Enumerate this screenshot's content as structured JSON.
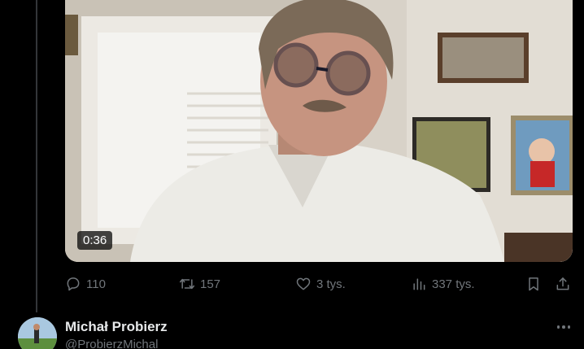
{
  "video": {
    "duration": "0:36"
  },
  "actions": {
    "replies": "110",
    "reposts": "157",
    "likes": "3 tys.",
    "views": "337 tys."
  },
  "tweet": {
    "author_name": "Michał Probierz",
    "author_handle": "@ProbierzMichal"
  },
  "icons": [
    "reply-icon",
    "repost-icon",
    "like-icon",
    "views-icon",
    "bookmark-icon",
    "share-icon",
    "more-icon"
  ],
  "colors": {
    "background": "#000000",
    "text": "#e7e9ea",
    "muted": "#71767b"
  }
}
